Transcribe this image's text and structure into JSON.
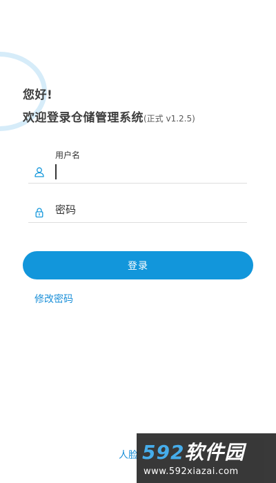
{
  "greeting": "您好!",
  "welcome": {
    "title": "欢迎登录仓储管理系统",
    "version": "(正式 v1.2.5)"
  },
  "username": {
    "label": "用户名",
    "value": "",
    "icon": "user-icon"
  },
  "password": {
    "placeholder": "密码",
    "icon": "lock-icon"
  },
  "login_button": "登录",
  "change_password": "修改密码",
  "face_login": "人脸",
  "watermark": {
    "logo_digits": "592",
    "logo_text": "软件园",
    "url": "www.592xiazai.com"
  },
  "colors": {
    "accent": "#1296db",
    "link": "#1a8fd8",
    "ring": "#d6ecf9",
    "text": "#3d3d3d"
  }
}
